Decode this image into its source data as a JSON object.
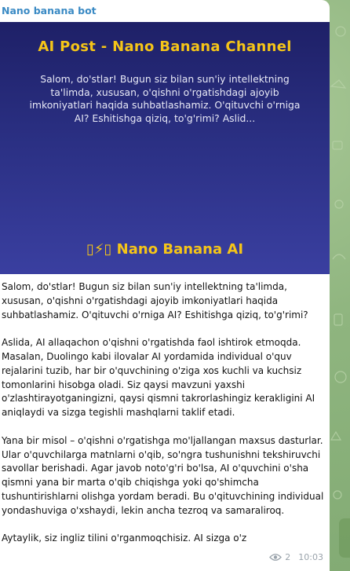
{
  "message": {
    "sender": "Nano banana bot",
    "banner": {
      "title": "AI Post - Nano Banana Channel",
      "text": "Salom, do'stlar! Bugun siz bilan sun'iy intellektning ta'limda, xususan, o'qishni o'rgatishdagi ajoyib imkoniyatlari haqida suhbatlashamiz. O'qituvchi o'rniga AI? Eshitishga qiziq, to'g'rimi? Aslid...",
      "footer": "▯⚡▯ Nano Banana AI"
    },
    "paragraphs": [
      "Salom, do'stlar! Bugun siz bilan sun'iy intellektning ta'limda, xususan, o'qishni o'rgatishdagi ajoyib imkoniyatlari haqida suhbatlashamiz. O'qituvchi o'rniga AI?  Eshitishga qiziq, to'g'rimi?",
      "Aslida, AI allaqachon o'qishni o'rgatishda faol ishtirok etmoqda. Masalan, Duolingo kabi ilovalar AI yordamida individual o'quv rejalarini tuzib,  har bir o'quvchining o'ziga xos kuchli va kuchsiz tomonlarini hisobga oladi.  Siz qaysi mavzuni yaxshi o'zlashtirayotganingizni, qaysi qismni takrorlashingiz kerakligini AI aniqlaydi va sizga tegishli mashqlarni taklif etadi.",
      "Yana bir misol –  o'qishni o'rgatishga mo'ljallangan maxsus dasturlar. Ular o'quvchilarga matnlarni o'qib, so'ngra tushunishni tekshiruvchi savollar berishadi.  Agar javob noto'g'ri bo'lsa, AI o'quvchini o'sha qismni yana bir marta o'qib chiqishga yoki qo'shimcha tushuntirishlarni olishga yordam beradi.  Bu o'qituvchining individual yondashuviga o'xshaydi, lekin ancha tezroq va samaraliroq.",
      "Aytaylik, siz ingliz tilini o'rganmoqchisiz.  AI sizga o'z"
    ],
    "views": "2",
    "time": "10:03"
  },
  "icons": {
    "views": "eye-icon"
  },
  "colors": {
    "sender": "#3a8ac4",
    "banner_title": "#f5c518",
    "banner_bg": "#2a2f82",
    "chat_bg": "#9bbf8a"
  }
}
